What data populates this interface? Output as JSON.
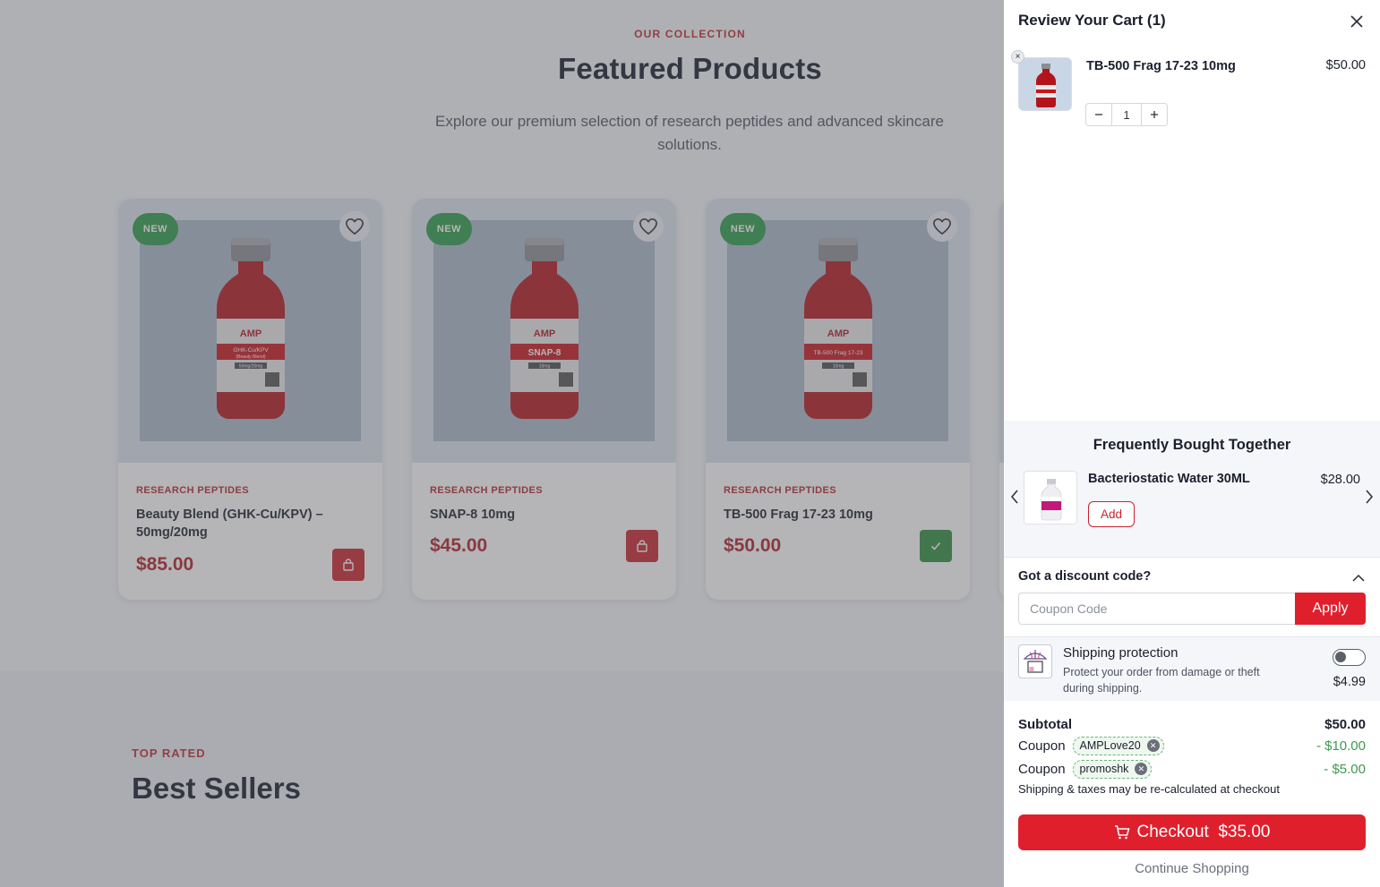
{
  "colors": {
    "brand_red": "#c8232c",
    "cta_red": "#e01f2d",
    "new_badge": "#2a9b4a",
    "added_green": "#2f8f3f",
    "discount_green": "#3d9a4e"
  },
  "featured": {
    "eyebrow": "OUR COLLECTION",
    "title": "Featured Products",
    "subtitle": "Explore our premium selection of research peptides and advanced skincare solutions.",
    "products": [
      {
        "badge": "NEW",
        "category": "RESEARCH PEPTIDES",
        "name": "Beauty Blend (GHK-Cu/KPV) – 50mg/20mg",
        "price": "$85.00",
        "label": "GHK-Cu/KPV",
        "label_sub": "(Beauty Blend)",
        "dose": "50mg/20mg",
        "in_cart": false,
        "icon": "bag-icon"
      },
      {
        "badge": "NEW",
        "category": "RESEARCH PEPTIDES",
        "name": "SNAP-8 10mg",
        "price": "$45.00",
        "label": "SNAP-8",
        "label_sub": "",
        "dose": "10mg",
        "in_cart": false,
        "icon": "bag-icon"
      },
      {
        "badge": "NEW",
        "category": "RESEARCH PEPTIDES",
        "name": "TB-500 Frag 17-23 10mg",
        "price": "$50.00",
        "label": "TB-500 Frag 17-23",
        "label_sub": "",
        "dose": "10mg",
        "in_cart": true,
        "icon": "check-icon"
      }
    ],
    "vial_brand": "AMP"
  },
  "bestsellers": {
    "eyebrow": "TOP RATED",
    "title": "Best Sellers"
  },
  "cart": {
    "title": "Review Your Cart (1)",
    "items": [
      {
        "name": "TB-500 Frag 17-23 10mg",
        "price": "$50.00",
        "qty": "1"
      }
    ],
    "fbt": {
      "title": "Frequently Bought Together",
      "item": {
        "name": "Bacteriostatic Water 30ML",
        "price": "$28.00",
        "add_label": "Add"
      }
    },
    "discount": {
      "title": "Got a discount code?",
      "placeholder": "Coupon Code",
      "apply_label": "Apply"
    },
    "shipping_protection": {
      "title": "Shipping protection",
      "description": "Protect your order from damage or theft during shipping.",
      "price": "$4.99",
      "enabled": false
    },
    "summary": {
      "subtotal_label": "Subtotal",
      "subtotal": "$50.00",
      "coupons": [
        {
          "label": "Coupon",
          "code": "AMPLove20",
          "amount": "- $10.00"
        },
        {
          "label": "Coupon",
          "code": "promoshk",
          "amount": "- $5.00"
        }
      ],
      "note": "Shipping & taxes may be re-calculated at checkout"
    },
    "checkout_label": "Checkout  $35.00",
    "continue_label": "Continue Shopping"
  }
}
